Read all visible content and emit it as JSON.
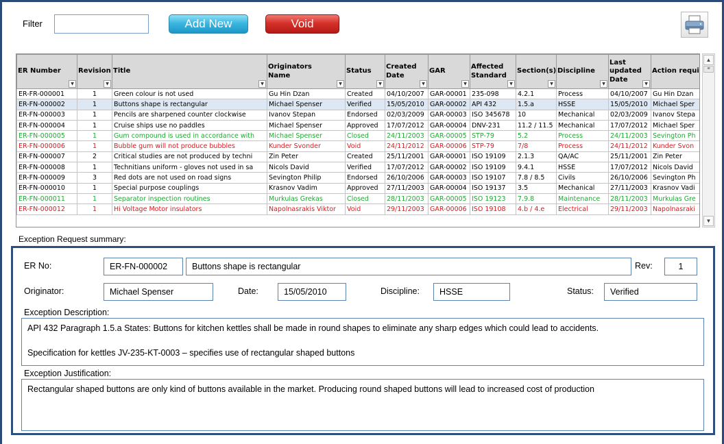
{
  "toolbar": {
    "filter_label": "Filter",
    "filter_value": "",
    "add_new_label": "Add New",
    "void_label": "Void",
    "print_icon": "printer-icon"
  },
  "colors": {
    "green": "#1fa833",
    "red": "#e0181e",
    "selected_row": "#dde8f4",
    "header_bg": "#d9d9d9"
  },
  "grid": {
    "columns": [
      "ER Number",
      "Revision",
      "Title",
      "Originators Name",
      "Status",
      "Created Date",
      "GAR",
      "Affected Standard",
      "Section(s)",
      "Discipline",
      "Last updated Date",
      "Action requi"
    ],
    "rows": [
      {
        "state": "normal",
        "cells": [
          "ER-FR-000001",
          "1",
          "Green colour is not used",
          "Gu Hin Dzan",
          "Created",
          "04/10/2007",
          "GAR-00001",
          "235-098",
          "4.2.1",
          "Process",
          "04/10/2007",
          "Gu Hin Dzan"
        ]
      },
      {
        "state": "selected",
        "cells": [
          "ER-FN-000002",
          "1",
          "Buttons shape is rectangular",
          "Michael Spenser",
          "Verified",
          "15/05/2010",
          "GAR-00002",
          "API 432",
          "1.5.a",
          "HSSE",
          "15/05/2010",
          "Michael Sper"
        ]
      },
      {
        "state": "normal",
        "cells": [
          "ER-FN-000003",
          "1",
          "Pencils are sharpened counter clockwise",
          "Ivanov Stepan",
          "Endorsed",
          "02/03/2009",
          "GAR-00003",
          "ISO 345678",
          "10",
          "Mechanical",
          "02/03/2009",
          "Ivanov Stepa"
        ]
      },
      {
        "state": "normal",
        "cells": [
          "ER-FN-000004",
          "1",
          "Cruise ships use no paddles",
          "Michael Spenser",
          "Approved",
          "17/07/2012",
          "GAR-00004",
          "DNV-231",
          "11.2 / 11.5",
          "Mechanical",
          "17/07/2012",
          "Michael Sper"
        ]
      },
      {
        "state": "green",
        "cells": [
          "ER-FN-000005",
          "1",
          "Gum compound is used in accordance with",
          "Michael Spenser",
          "Closed",
          "24/11/2003",
          "GAR-00005",
          "STP-79",
          "5.2",
          "Process",
          "24/11/2003",
          "Sevington Ph"
        ]
      },
      {
        "state": "red",
        "cells": [
          "ER-FN-000006",
          "1",
          "Bubble gum will not produce bubbles",
          "Kunder Svonder",
          "Void",
          "24/11/2012",
          "GAR-00006",
          "STP-79",
          "7/8",
          "Process",
          "24/11/2012",
          "Kunder Svon"
        ]
      },
      {
        "state": "normal",
        "cells": [
          "ER-FN-000007",
          "2",
          "Critical studies are not produced by techni",
          "Zin Peter",
          "Created",
          "25/11/2001",
          "GAR-00001",
          "ISO 19109",
          "2.1.3",
          "QA/AC",
          "25/11/2001",
          "Zin Peter"
        ]
      },
      {
        "state": "normal",
        "cells": [
          "ER-FN-000008",
          "1",
          "Technitians uniform - gloves not used in sa",
          "Nicols David",
          "Verified",
          "17/07/2012",
          "GAR-00002",
          "ISO 19109",
          "9.4.1",
          "HSSE",
          "17/07/2012",
          "Nicols David"
        ]
      },
      {
        "state": "normal",
        "cells": [
          "ER-FN-000009",
          "3",
          "Red dots are not used on road signs",
          "Sevington Philip",
          "Endorsed",
          "26/10/2006",
          "GAR-00003",
          "ISO 19107",
          "7.8 / 8.5",
          "Civils",
          "26/10/2006",
          "Sevington Ph"
        ]
      },
      {
        "state": "normal",
        "cells": [
          "ER-FN-000010",
          "1",
          "Special purpose couplings",
          "Krasnov Vadim",
          "Approved",
          "27/11/2003",
          "GAR-00004",
          "ISO 19137",
          "3.5",
          "Mechanical",
          "27/11/2003",
          "Krasnov Vadi"
        ]
      },
      {
        "state": "green",
        "cells": [
          "ER-FN-000011",
          "1",
          "Separator inspection routines",
          "Murkulas Grekas",
          "Closed",
          "28/11/2003",
          "GAR-00005",
          "ISO 19123",
          "7.9.8",
          "Maintenance",
          "28/11/2003",
          "Murkulas Gre"
        ]
      },
      {
        "state": "red",
        "cells": [
          "ER-FN-000012",
          "1",
          "Hi Voltage Motor insulators",
          "Napolnasrakis Viktor",
          "Void",
          "29/11/2003",
          "GAR-00006",
          "ISO 19108",
          "4.b / 4.e",
          "Electrical",
          "29/11/2003",
          "Napolnasraki"
        ]
      }
    ]
  },
  "summary": {
    "title": "Exception Request summary:",
    "er_no_label": "ER No:",
    "er_no": "ER-FN-000002",
    "er_title": "Buttons shape is rectangular",
    "rev_label": "Rev:",
    "rev": "1",
    "originator_label": "Originator:",
    "originator": "Michael Spenser",
    "date_label": "Date:",
    "date": "15/05/2010",
    "discipline_label": "Discipline:",
    "discipline": "HSSE",
    "status_label": "Status:",
    "status": "Verified",
    "description_label": "Exception Description:",
    "description_line1": "API 432 Paragraph 1.5.a States:  Buttons for kitchen kettles shall be made in round shapes to eliminate any sharp edges which could lead to accidents.",
    "description_line2": "Specification for kettles JV-235-KT-0003 – specifies use of rectangular shaped buttons",
    "justification_label": "Exception Justification:",
    "justification": "Rectangular shaped buttons are only kind of buttons available in the market. Producing round shaped buttons will lead to increased cost of production"
  }
}
